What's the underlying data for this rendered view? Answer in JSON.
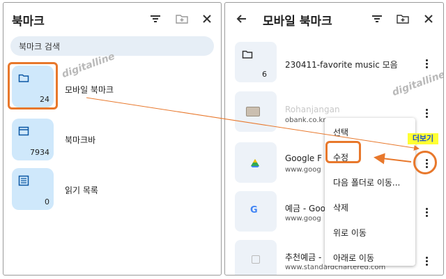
{
  "left": {
    "title": "북마크",
    "search_placeholder": "북마크 검색",
    "folders": [
      {
        "label": "모바일 북마크",
        "count": "24",
        "icon": "folder-icon"
      },
      {
        "label": "북마크바",
        "count": "7934",
        "icon": "bookmark-bar-icon"
      },
      {
        "label": "읽기 목록",
        "count": "0",
        "icon": "reading-list-icon"
      }
    ]
  },
  "right": {
    "title": "모바일 북마크",
    "items": [
      {
        "title": "230411-favorite music 모음",
        "url": "",
        "count": "6",
        "icon": "folder-icon"
      },
      {
        "title": "Rohanjangan",
        "url": "obank.co.kr",
        "count": "",
        "icon": "thumbnail-icon"
      },
      {
        "title": "Google F",
        "url": "www.goog",
        "count": "",
        "icon": "google-drive-icon"
      },
      {
        "title": "예금 - Goo",
        "url": "www.goog",
        "count": "",
        "icon": "google-icon"
      },
      {
        "title": "추천예금 -",
        "url": "www.standardchartered.com",
        "count": "",
        "icon": "generic-site-icon"
      }
    ]
  },
  "menu": {
    "items": [
      "선택",
      "수정",
      "다음 폴더로 이동...",
      "삭제",
      "위로 이동",
      "아래로 이동"
    ]
  },
  "annotation": {
    "callout": "더보기",
    "accent_color": "#e8782c",
    "callout_bg": "#ffff33"
  },
  "watermark": "digitalline"
}
